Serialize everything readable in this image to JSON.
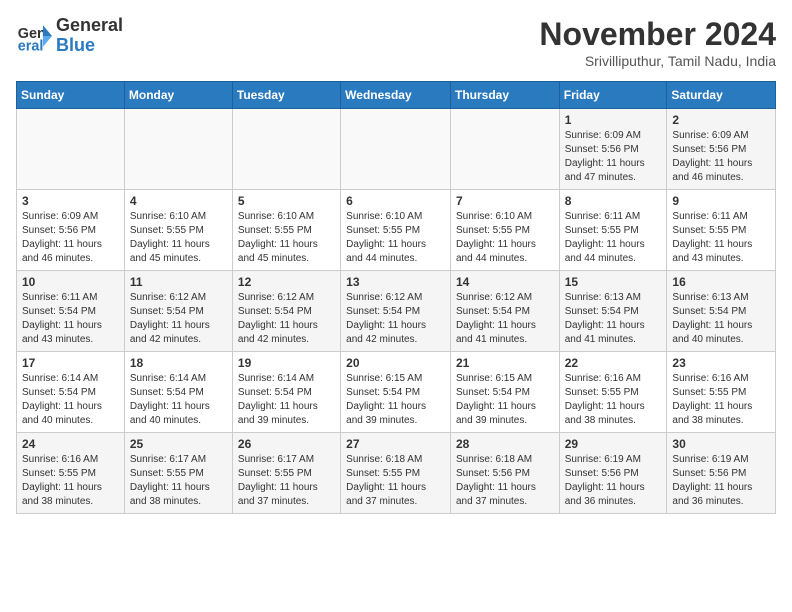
{
  "logo": {
    "general": "General",
    "blue": "Blue"
  },
  "title": "November 2024",
  "location": "Srivilliputhur, Tamil Nadu, India",
  "headers": [
    "Sunday",
    "Monday",
    "Tuesday",
    "Wednesday",
    "Thursday",
    "Friday",
    "Saturday"
  ],
  "weeks": [
    [
      {
        "day": "",
        "info": ""
      },
      {
        "day": "",
        "info": ""
      },
      {
        "day": "",
        "info": ""
      },
      {
        "day": "",
        "info": ""
      },
      {
        "day": "",
        "info": ""
      },
      {
        "day": "1",
        "info": "Sunrise: 6:09 AM\nSunset: 5:56 PM\nDaylight: 11 hours\nand 47 minutes."
      },
      {
        "day": "2",
        "info": "Sunrise: 6:09 AM\nSunset: 5:56 PM\nDaylight: 11 hours\nand 46 minutes."
      }
    ],
    [
      {
        "day": "3",
        "info": "Sunrise: 6:09 AM\nSunset: 5:56 PM\nDaylight: 11 hours\nand 46 minutes."
      },
      {
        "day": "4",
        "info": "Sunrise: 6:10 AM\nSunset: 5:55 PM\nDaylight: 11 hours\nand 45 minutes."
      },
      {
        "day": "5",
        "info": "Sunrise: 6:10 AM\nSunset: 5:55 PM\nDaylight: 11 hours\nand 45 minutes."
      },
      {
        "day": "6",
        "info": "Sunrise: 6:10 AM\nSunset: 5:55 PM\nDaylight: 11 hours\nand 44 minutes."
      },
      {
        "day": "7",
        "info": "Sunrise: 6:10 AM\nSunset: 5:55 PM\nDaylight: 11 hours\nand 44 minutes."
      },
      {
        "day": "8",
        "info": "Sunrise: 6:11 AM\nSunset: 5:55 PM\nDaylight: 11 hours\nand 44 minutes."
      },
      {
        "day": "9",
        "info": "Sunrise: 6:11 AM\nSunset: 5:55 PM\nDaylight: 11 hours\nand 43 minutes."
      }
    ],
    [
      {
        "day": "10",
        "info": "Sunrise: 6:11 AM\nSunset: 5:54 PM\nDaylight: 11 hours\nand 43 minutes."
      },
      {
        "day": "11",
        "info": "Sunrise: 6:12 AM\nSunset: 5:54 PM\nDaylight: 11 hours\nand 42 minutes."
      },
      {
        "day": "12",
        "info": "Sunrise: 6:12 AM\nSunset: 5:54 PM\nDaylight: 11 hours\nand 42 minutes."
      },
      {
        "day": "13",
        "info": "Sunrise: 6:12 AM\nSunset: 5:54 PM\nDaylight: 11 hours\nand 42 minutes."
      },
      {
        "day": "14",
        "info": "Sunrise: 6:12 AM\nSunset: 5:54 PM\nDaylight: 11 hours\nand 41 minutes."
      },
      {
        "day": "15",
        "info": "Sunrise: 6:13 AM\nSunset: 5:54 PM\nDaylight: 11 hours\nand 41 minutes."
      },
      {
        "day": "16",
        "info": "Sunrise: 6:13 AM\nSunset: 5:54 PM\nDaylight: 11 hours\nand 40 minutes."
      }
    ],
    [
      {
        "day": "17",
        "info": "Sunrise: 6:14 AM\nSunset: 5:54 PM\nDaylight: 11 hours\nand 40 minutes."
      },
      {
        "day": "18",
        "info": "Sunrise: 6:14 AM\nSunset: 5:54 PM\nDaylight: 11 hours\nand 40 minutes."
      },
      {
        "day": "19",
        "info": "Sunrise: 6:14 AM\nSunset: 5:54 PM\nDaylight: 11 hours\nand 39 minutes."
      },
      {
        "day": "20",
        "info": "Sunrise: 6:15 AM\nSunset: 5:54 PM\nDaylight: 11 hours\nand 39 minutes."
      },
      {
        "day": "21",
        "info": "Sunrise: 6:15 AM\nSunset: 5:54 PM\nDaylight: 11 hours\nand 39 minutes."
      },
      {
        "day": "22",
        "info": "Sunrise: 6:16 AM\nSunset: 5:55 PM\nDaylight: 11 hours\nand 38 minutes."
      },
      {
        "day": "23",
        "info": "Sunrise: 6:16 AM\nSunset: 5:55 PM\nDaylight: 11 hours\nand 38 minutes."
      }
    ],
    [
      {
        "day": "24",
        "info": "Sunrise: 6:16 AM\nSunset: 5:55 PM\nDaylight: 11 hours\nand 38 minutes."
      },
      {
        "day": "25",
        "info": "Sunrise: 6:17 AM\nSunset: 5:55 PM\nDaylight: 11 hours\nand 38 minutes."
      },
      {
        "day": "26",
        "info": "Sunrise: 6:17 AM\nSunset: 5:55 PM\nDaylight: 11 hours\nand 37 minutes."
      },
      {
        "day": "27",
        "info": "Sunrise: 6:18 AM\nSunset: 5:55 PM\nDaylight: 11 hours\nand 37 minutes."
      },
      {
        "day": "28",
        "info": "Sunrise: 6:18 AM\nSunset: 5:56 PM\nDaylight: 11 hours\nand 37 minutes."
      },
      {
        "day": "29",
        "info": "Sunrise: 6:19 AM\nSunset: 5:56 PM\nDaylight: 11 hours\nand 36 minutes."
      },
      {
        "day": "30",
        "info": "Sunrise: 6:19 AM\nSunset: 5:56 PM\nDaylight: 11 hours\nand 36 minutes."
      }
    ]
  ]
}
